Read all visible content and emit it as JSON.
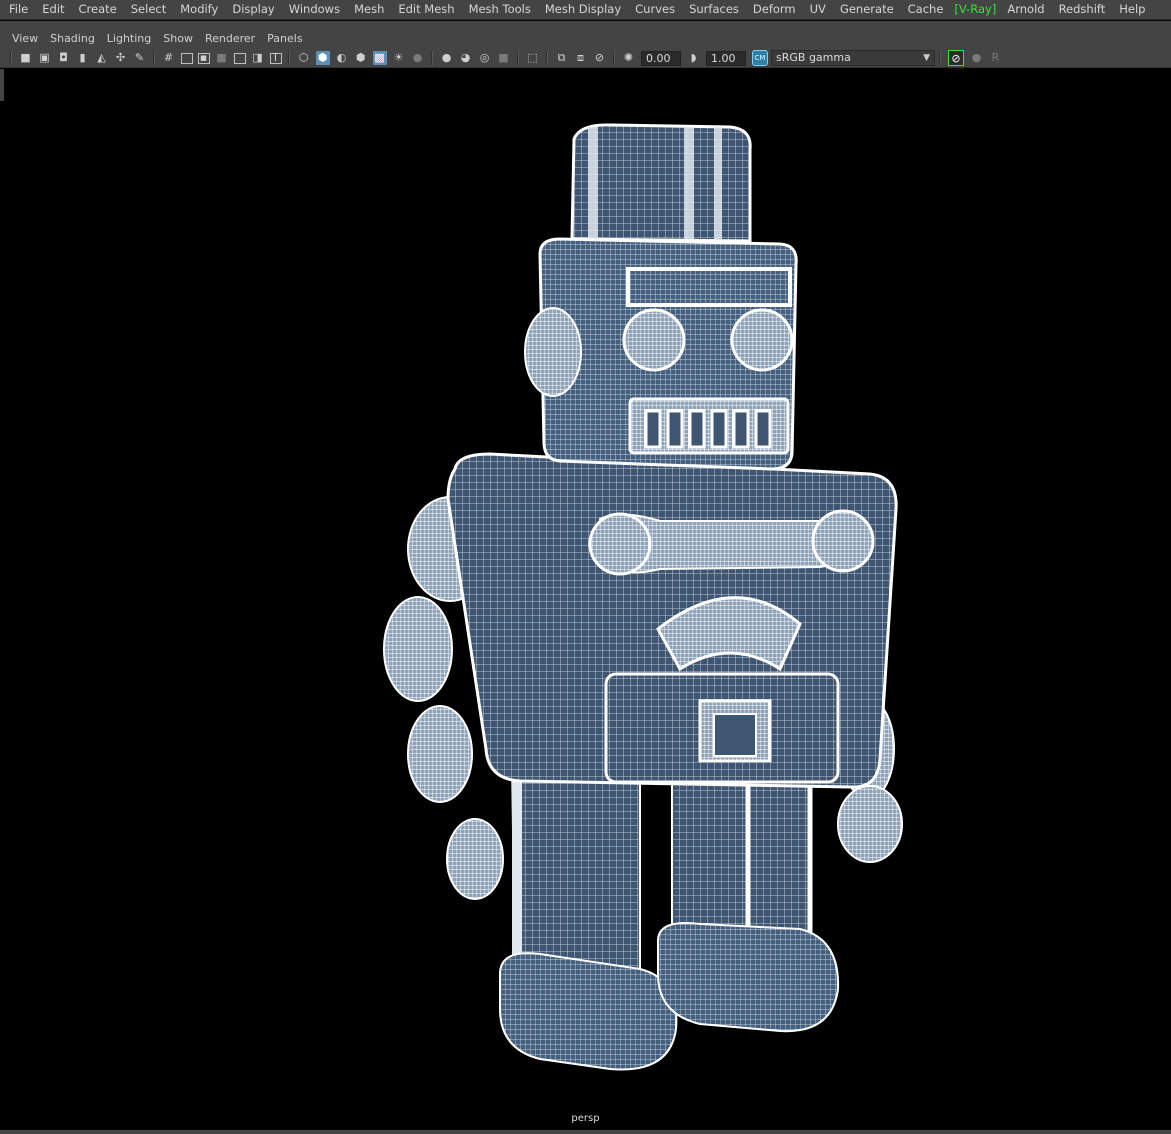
{
  "main_menu": {
    "items": [
      "File",
      "Edit",
      "Create",
      "Select",
      "Modify",
      "Display",
      "Windows",
      "Mesh",
      "Edit Mesh",
      "Mesh Tools",
      "Mesh Display",
      "Curves",
      "Surfaces",
      "Deform",
      "UV",
      "Generate",
      "Cache"
    ],
    "vray_label": "V-Ray",
    "after_items": [
      "Arnold",
      "Redshift",
      "Help"
    ]
  },
  "panel_menu": {
    "items": [
      "View",
      "Shading",
      "Lighting",
      "Show",
      "Renderer",
      "Panels"
    ]
  },
  "toolbar": {
    "exposure_value": "0.00",
    "gamma_value": "1.00",
    "color_space": "sRGB gamma"
  },
  "viewport": {
    "camera_label": "persp",
    "background": "#000000",
    "mesh_fill": "#3f5672",
    "wire_color": "#ffffff"
  },
  "colors": {
    "chrome_bg": "#444444",
    "vray_accent": "#36e33c",
    "active_icon": "#5c8fb4"
  }
}
